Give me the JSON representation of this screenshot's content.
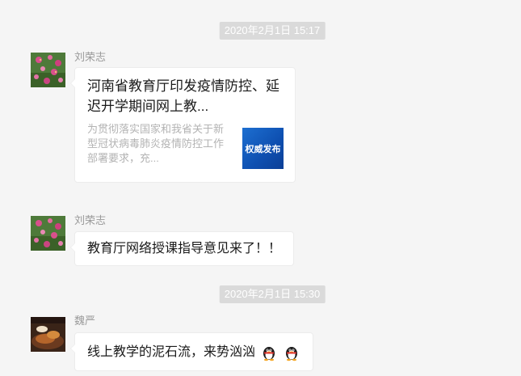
{
  "timestamps": [
    "2020年2月1日 15:17",
    "2020年2月1日 15:30"
  ],
  "messages": [
    {
      "sender": "刘荣志",
      "avatar": "flower-photo-avatar",
      "type": "link-card",
      "card_title": "河南省教育厅印发疫情防控、延迟开学期间网上教...",
      "card_desc": "为贯彻落实国家和我省关于新型冠状病毒肺炎疫情防控工作部署要求，充...",
      "thumb_label": "权威发布"
    },
    {
      "sender": "刘荣志",
      "avatar": "flower-photo-avatar",
      "type": "text",
      "text": "教育厅网络授课指导意见来了！！"
    },
    {
      "sender": "魏严",
      "avatar": "food-photo-avatar",
      "type": "text",
      "text": "线上教学的泥石流，来势汹汹",
      "emojis": [
        "penguin-emoji",
        "penguin-emoji"
      ]
    }
  ]
}
